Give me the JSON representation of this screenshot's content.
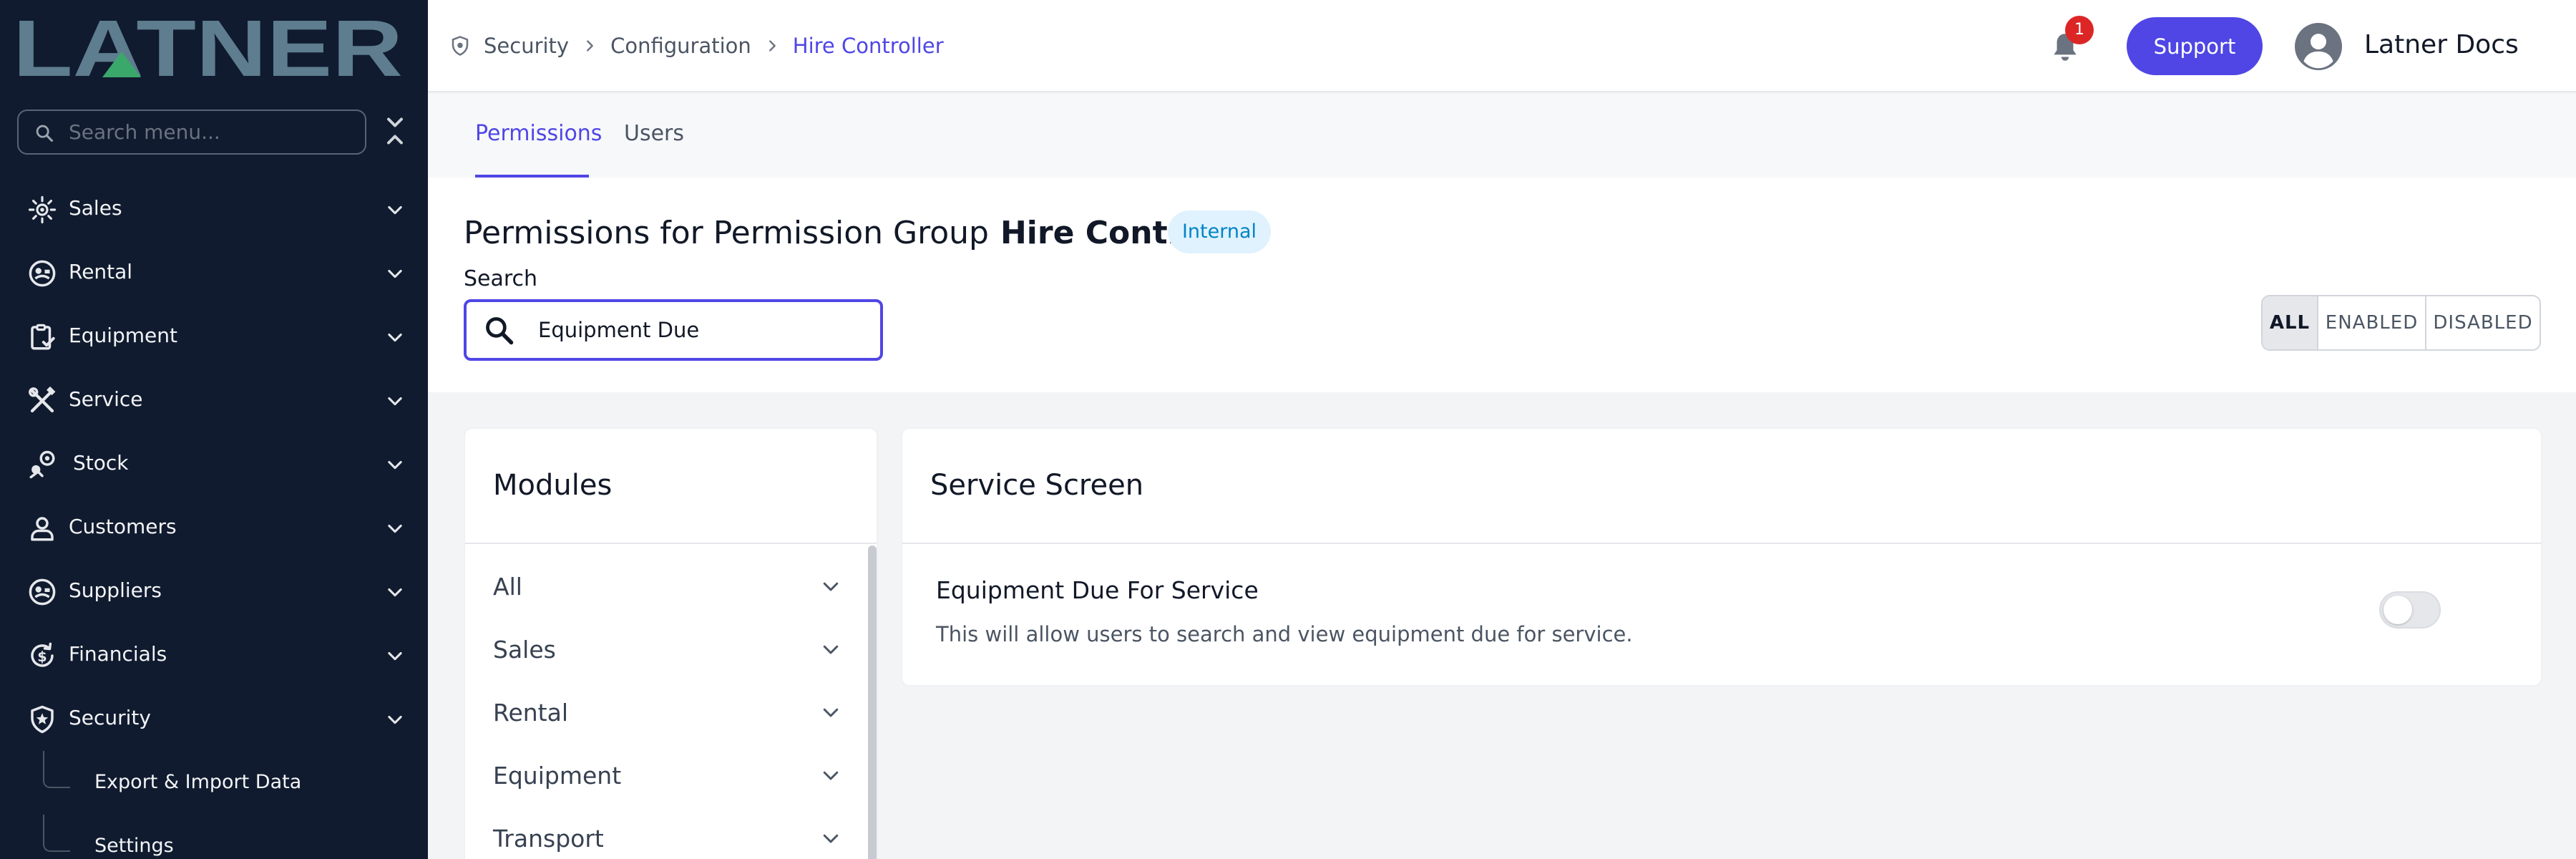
{
  "app": {
    "logo_text": "LATNER"
  },
  "colors": {
    "sidebar_bg": "#101b2f",
    "accent": "#4f46e5",
    "logo": "#5e7d8f",
    "logo_triangle": "#3aa86b",
    "badge_red": "#dc2626",
    "internal_badge_bg": "#e0f2fe",
    "internal_badge_text": "#0284c7"
  },
  "sidebar": {
    "search_placeholder": "Search menu...",
    "items": [
      {
        "label": "Sales",
        "icon": "sales-icon",
        "expanded": false
      },
      {
        "label": "Rental",
        "icon": "rental-icon",
        "expanded": false
      },
      {
        "label": "Equipment",
        "icon": "clipboard-check-icon",
        "expanded": false
      },
      {
        "label": "Service",
        "icon": "tools-icon",
        "expanded": false
      },
      {
        "label": "Stock",
        "icon": "stock-icon",
        "expanded": false
      },
      {
        "label": "Customers",
        "icon": "user-icon",
        "expanded": false
      },
      {
        "label": "Suppliers",
        "icon": "suppliers-icon",
        "expanded": false
      },
      {
        "label": "Financials",
        "icon": "financials-icon",
        "expanded": false
      },
      {
        "label": "Security",
        "icon": "shield-star-icon",
        "expanded": true
      }
    ],
    "security_subitems": [
      {
        "label": "Export & Import Data"
      },
      {
        "label": "Settings"
      }
    ]
  },
  "header": {
    "breadcrumb": [
      {
        "label": "Security"
      },
      {
        "label": "Configuration"
      },
      {
        "label": "Hire Controller"
      }
    ],
    "notifications_count": "1",
    "support_label": "Support",
    "user_name": "Latner Docs"
  },
  "tabs": [
    {
      "label": "Permissions",
      "active": true
    },
    {
      "label": "Users",
      "active": false
    }
  ],
  "page": {
    "title_prefix": "Permissions for Permission Group",
    "group_name": "Hire Controller",
    "group_badge": "Internal",
    "search_label": "Search",
    "search_value": "Equipment Due",
    "filters": [
      {
        "label": "ALL",
        "active": true
      },
      {
        "label": "ENABLED",
        "active": false
      },
      {
        "label": "DISABLED",
        "active": false
      }
    ]
  },
  "modules": {
    "title": "Modules",
    "items": [
      {
        "label": "All"
      },
      {
        "label": "Sales"
      },
      {
        "label": "Rental"
      },
      {
        "label": "Equipment"
      },
      {
        "label": "Transport"
      }
    ]
  },
  "service_screen": {
    "title": "Service Screen",
    "permissions": [
      {
        "title": "Equipment Due For Service",
        "description": "This will allow users to search and view equipment due for service.",
        "enabled": false
      }
    ]
  }
}
